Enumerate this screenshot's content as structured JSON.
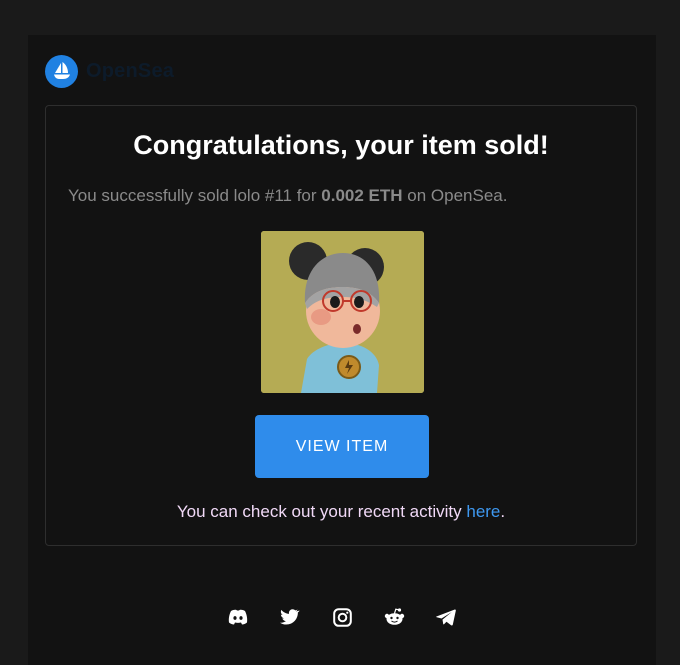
{
  "brand": {
    "name": "OpenSea",
    "color": "#2081e2"
  },
  "card": {
    "headline": "Congratulations, your item sold!",
    "sold_prefix": "You successfully sold lolo #11 for ",
    "price": "0.002 ETH",
    "sold_suffix": " on OpenSea.",
    "image_icon": "nft-character-image",
    "button_label": "VIEW ITEM",
    "activity_text": "You can check out your recent activity ",
    "activity_link": "here",
    "activity_end": "."
  },
  "footer": {
    "socials": [
      "discord-icon",
      "twitter-icon",
      "instagram-icon",
      "reddit-icon",
      "telegram-icon"
    ]
  },
  "colors": {
    "button": "#2f8ceb",
    "link": "#3e98f0",
    "background": "#121212"
  }
}
